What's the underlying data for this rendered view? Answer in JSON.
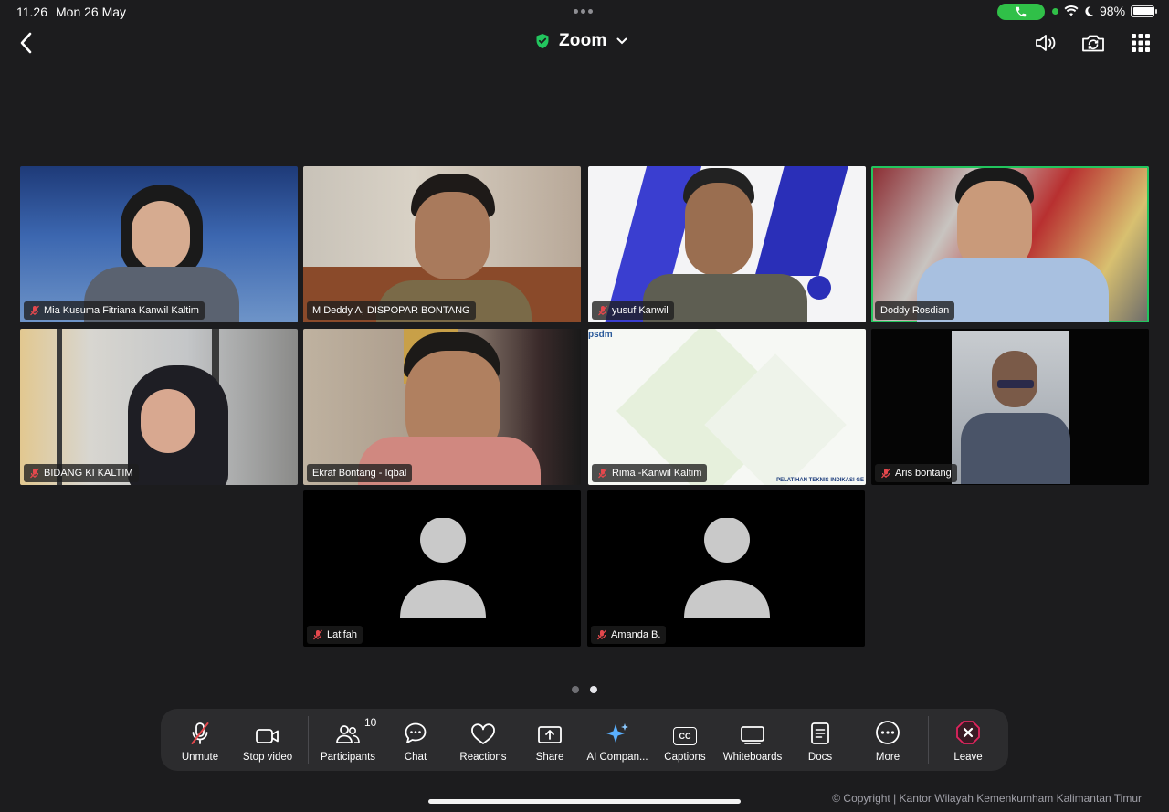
{
  "status": {
    "time": "11.26",
    "date": "Mon 26 May",
    "battery": "98%",
    "battery_level": 0.98
  },
  "header": {
    "title": "Zoom"
  },
  "participants": [
    {
      "name": "Mia Kusuma Fitriana Kanwil Kaltim",
      "muted": true,
      "video": true
    },
    {
      "name": "M Deddy A, DISPOPAR BONTANG",
      "muted": false,
      "video": true
    },
    {
      "name": "yusuf Kanwil",
      "muted": true,
      "video": true
    },
    {
      "name": "Doddy Rosdian",
      "muted": false,
      "video": true,
      "speaking": true
    },
    {
      "name": "BIDANG KI KALTIM",
      "muted": true,
      "video": true
    },
    {
      "name": "Ekraf Bontang - Iqbal",
      "muted": false,
      "video": true
    },
    {
      "name": "Rima -Kanwil  Kaltim",
      "muted": true,
      "video": true
    },
    {
      "name": "Aris bontang",
      "muted": true,
      "video": true
    },
    {
      "name": "Latifah",
      "muted": true,
      "video": false
    },
    {
      "name": "Amanda B.",
      "muted": true,
      "video": false
    }
  ],
  "screen_share_text": {
    "logo": "psdm",
    "footer": "PELATIHAN TEKNIS INDIKASI GE"
  },
  "pagination": {
    "total": 2,
    "current": 2
  },
  "toolbar": {
    "unmute": "Unmute",
    "stop_video": "Stop video",
    "participants": "Participants",
    "participants_count": "10",
    "chat": "Chat",
    "reactions": "Reactions",
    "share": "Share",
    "ai_companion": "AI Compan...",
    "captions": "Captions",
    "captions_icon_text": "CC",
    "whiteboards": "Whiteboards",
    "docs": "Docs",
    "more": "More",
    "leave": "Leave"
  },
  "footer": {
    "copyright": "© Copyright | Kantor Wilayah Kemenkumham Kalimantan Timur"
  },
  "colors": {
    "background": "#1c1c1e",
    "toolbar": "#2c2c2e",
    "active_speaker": "#22c55e",
    "muted_red": "#e5484d",
    "leave_red": "#e0245e",
    "call_green": "#30c048"
  }
}
